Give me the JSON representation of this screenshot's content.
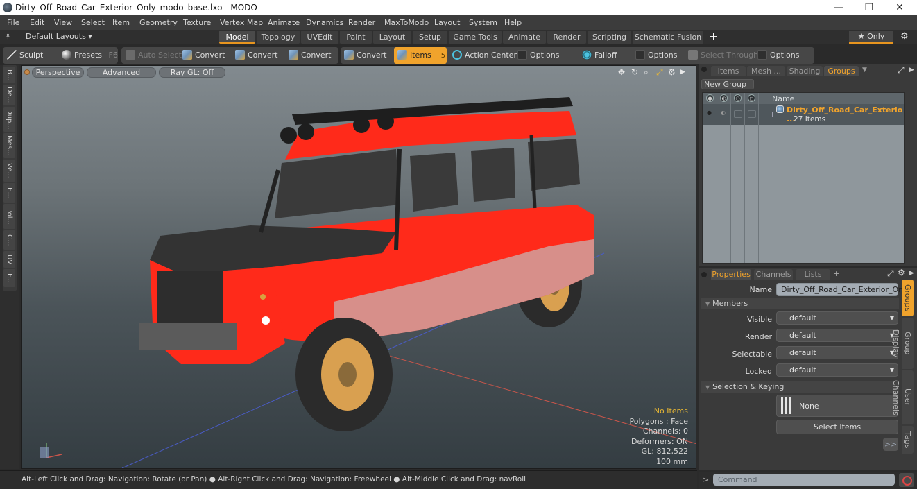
{
  "window": {
    "title": "Dirty_Off_Road_Car_Exterior_Only_modo_base.lxo - MODO",
    "controls": [
      "—",
      "❐",
      "✕"
    ]
  },
  "menu": [
    "File",
    "Edit",
    "View",
    "Select",
    "Item",
    "Geometry",
    "Texture",
    "Vertex Map",
    "Animate",
    "Dynamics",
    "Render",
    "MaxToModo",
    "Layout",
    "System",
    "Help"
  ],
  "layoutbar": {
    "layouts_label": "Default Layouts ▾",
    "tabs": [
      "Model",
      "Topology",
      "UVEdit",
      "Paint",
      "Layout",
      "Setup",
      "Game Tools",
      "Animate",
      "Render",
      "Scripting",
      "Schematic Fusion"
    ],
    "active_tab": "Model",
    "add_tab": "+",
    "only_label": "★ Only"
  },
  "toolbar": {
    "sculpt": "Sculpt",
    "presets": "Presets",
    "presets_key": "F6",
    "auto_select": "Auto Select",
    "convert1": "Convert",
    "convert2": "Convert",
    "convert3": "Convert",
    "convert4": "Convert",
    "items": "Items",
    "items_key": "5",
    "action_center": "Action Center",
    "options1": "Options",
    "falloff": "Falloff",
    "options2": "Options",
    "select_through": "Select Through",
    "options3": "Options"
  },
  "left_tabs": [
    "B...",
    "De...",
    "Dup...",
    "Mes...",
    "Ve...",
    "E...",
    "Pol...",
    "C...",
    "UV",
    "F..."
  ],
  "viewport": {
    "view_mode": "Perspective",
    "shading": "Advanced",
    "raygl": "Ray GL: Off",
    "info": {
      "selection": "No Items",
      "polygons": "Polygons : Face",
      "channels": "Channels: 0",
      "deformers": "Deformers: ON",
      "gl": "GL: 812,522",
      "scale": "100 mm"
    }
  },
  "statusbar": {
    "hint1": "Alt-Left Click and Drag: Navigation: Rotate (or Pan)",
    "hint2": "Alt-Right Click and Drag: Navigation: Freewheel",
    "hint3": "Alt-Middle Click and Drag: navRoll"
  },
  "groups_panel": {
    "tabs": [
      "Items",
      "Mesh ...",
      "Shading",
      "Groups"
    ],
    "active_tab": "Groups",
    "new_group": "New Group",
    "column_name": "Name",
    "groups": [
      {
        "name": "Dirty_Off_Road_Car_Exterio ...",
        "count": "27 Items"
      }
    ]
  },
  "properties_panel": {
    "tabs": [
      "Properties",
      "Channels",
      "Lists"
    ],
    "active_tab": "Properties",
    "add_tab": "+",
    "name_label": "Name",
    "name_value": "Dirty_Off_Road_Car_Exterior_Only",
    "members_section": "Members",
    "fields": [
      {
        "label": "Visible",
        "value": "default"
      },
      {
        "label": "Render",
        "value": "default"
      },
      {
        "label": "Selectable",
        "value": "default"
      },
      {
        "label": "Locked",
        "value": "default"
      }
    ],
    "selection_section": "Selection & Keying",
    "none_label": "None",
    "select_items": "Select Items",
    "more": ">>",
    "side_tabs": [
      "Groups",
      "Group Display",
      "User Channels",
      "Tags"
    ],
    "active_side_tab": "Groups"
  },
  "command": {
    "prompt": ">",
    "placeholder": "Command"
  },
  "colors": {
    "accent": "#f0a32c",
    "highlight_text": "#e8b734",
    "car_body": "#ff2a1a"
  }
}
